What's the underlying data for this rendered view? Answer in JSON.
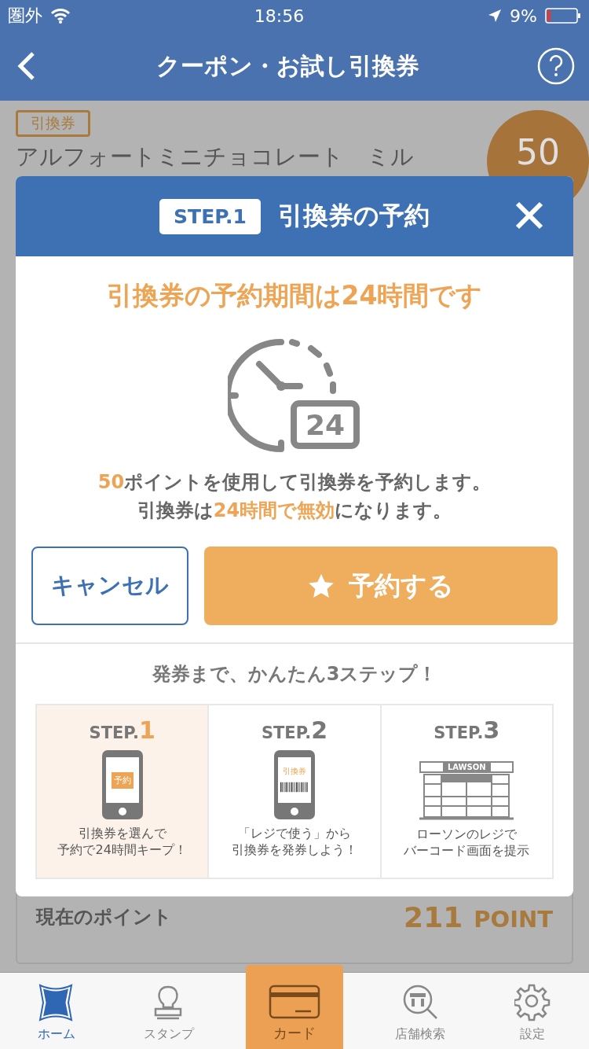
{
  "status_bar": {
    "carrier": "圏外",
    "time": "18:56",
    "battery": "9%"
  },
  "nav": {
    "title": "クーポン・お試し引換券"
  },
  "coupon": {
    "tag": "引換券",
    "title": "アルフォートミニチョコレート　ミル",
    "points": "50"
  },
  "point_card": {
    "label": "現在のポイント",
    "value": "211",
    "unit": "POINT"
  },
  "modal": {
    "step_badge": "STEP.1",
    "title": "引換券の予約",
    "headline": "引換券の予約期間は24時間です",
    "clock_number": "24",
    "message": [
      "**50**ポイントを使用して引換券を予約します。",
      "引換券は**24時間で無効**になります。"
    ],
    "cancel_button": "キャンセル",
    "confirm_button": "予約する",
    "steps_title": "発券まで、かんたん3ステップ！",
    "steps": [
      {
        "kind": "reserve",
        "label": "STEP.**1**",
        "screen_text": "予約",
        "caption": [
          "引換券を選んで",
          "予約で24時間キープ！"
        ],
        "selected": true
      },
      {
        "kind": "barcode",
        "label": "STEP.**2**",
        "screen_text": "引換券",
        "caption": [
          "「レジで使う」から",
          "引換券を発券しよう！"
        ],
        "selected": false
      },
      {
        "kind": "store",
        "label": "STEP.**3**",
        "screen_text": "LAWSON",
        "caption": [
          "ローソンのレジで",
          "バーコード画面を提示"
        ],
        "selected": false
      }
    ]
  },
  "tabs": [
    {
      "kind": "home",
      "label": "ホーム",
      "selected": true
    },
    {
      "kind": "stamp",
      "label": "スタンプ",
      "selected": false
    },
    {
      "kind": "card",
      "label": "カード",
      "selected": false,
      "raised": true
    },
    {
      "kind": "store",
      "label": "店舗検索",
      "selected": false
    },
    {
      "kind": "settings",
      "label": "設定",
      "selected": false
    }
  ]
}
